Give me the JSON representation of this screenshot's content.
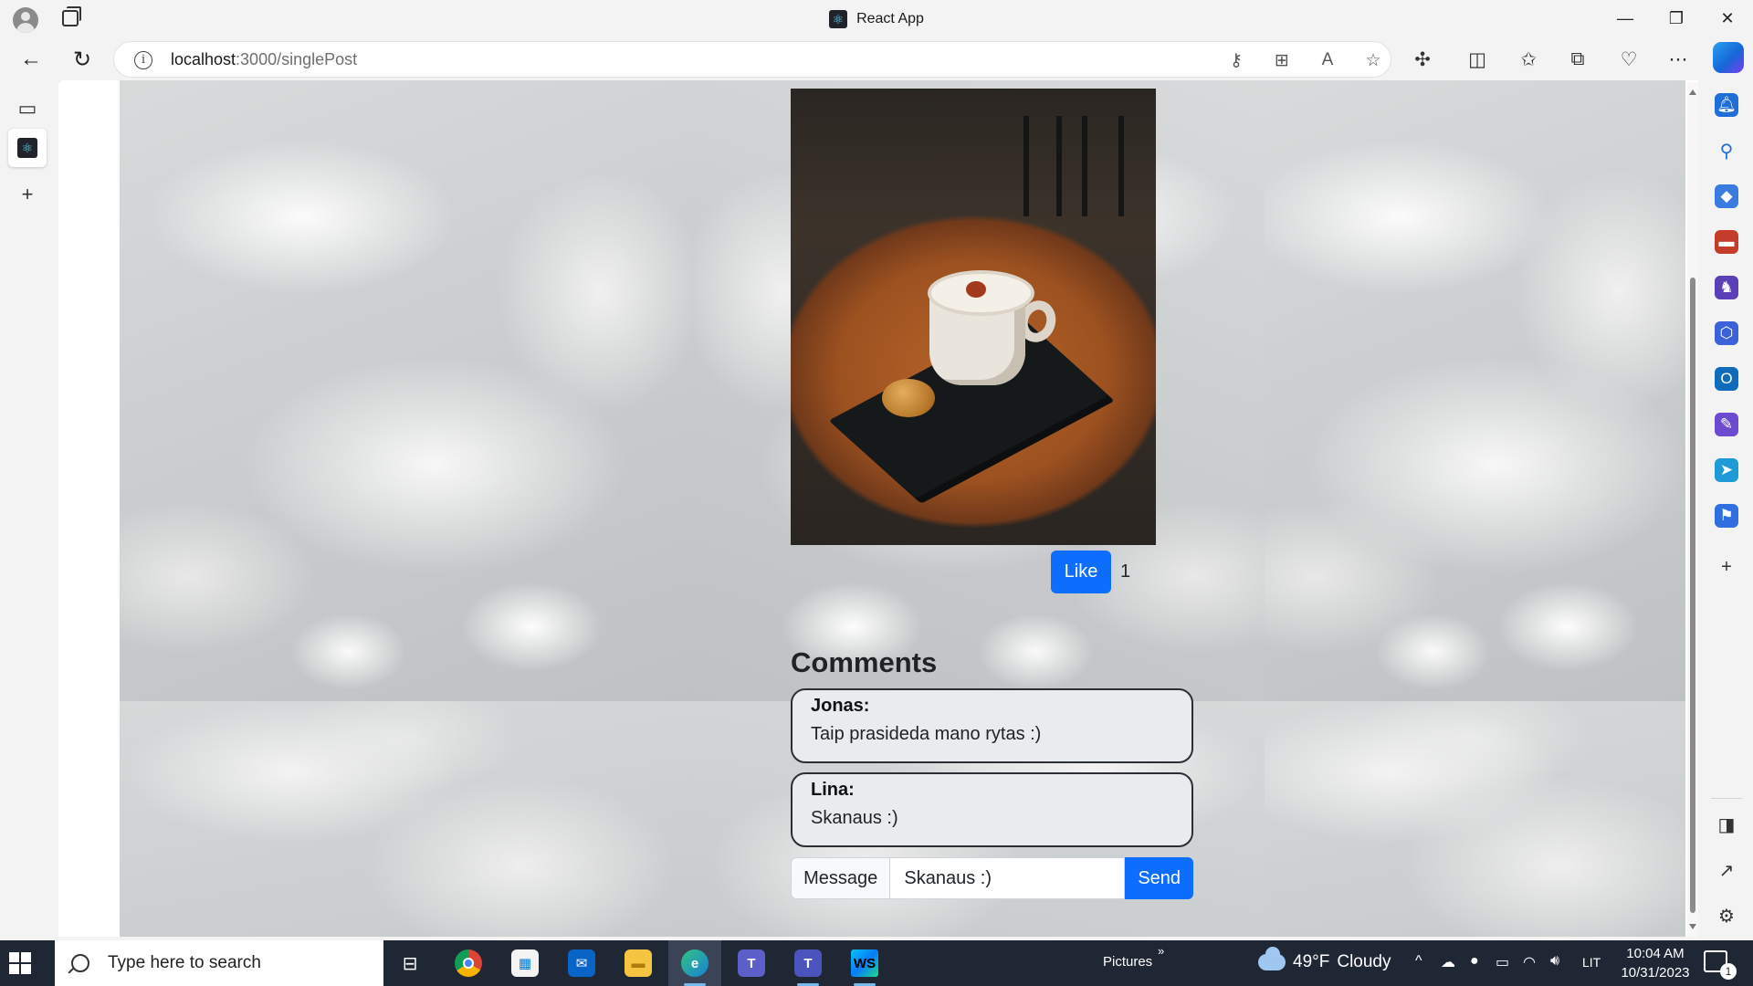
{
  "browser": {
    "window_title": "React App",
    "address": {
      "host": "localhost",
      "path": ":3000/singlePost"
    }
  },
  "post": {
    "like_label": "Like",
    "like_count": "1"
  },
  "comments": {
    "title": "Comments",
    "items": [
      {
        "author": "Jonas:",
        "text": "Taip prasideda mano rytas :)"
      },
      {
        "author": "Lina:",
        "text": "Skanaus :)"
      }
    ]
  },
  "composer": {
    "label": "Message",
    "value": "Skanaus :)",
    "send_label": "Send"
  },
  "taskbar": {
    "search_placeholder": "Type here to search",
    "pinned": [
      "chrome",
      "microsoft-store",
      "mail",
      "file-explorer",
      "edge",
      "teams-new",
      "teams",
      "webstorm"
    ],
    "pictures_label": "Pictures",
    "pictures_chevron": "»",
    "weather": {
      "temp": "49°F",
      "condition": "Cloudy"
    },
    "language": "LIT",
    "time": "10:04 AM",
    "date": "10/31/2023",
    "notification_count": "1"
  },
  "colors": {
    "primary": "#0d6efd",
    "taskbar": "#1f2735",
    "comment_bg": "#e9ecef"
  }
}
